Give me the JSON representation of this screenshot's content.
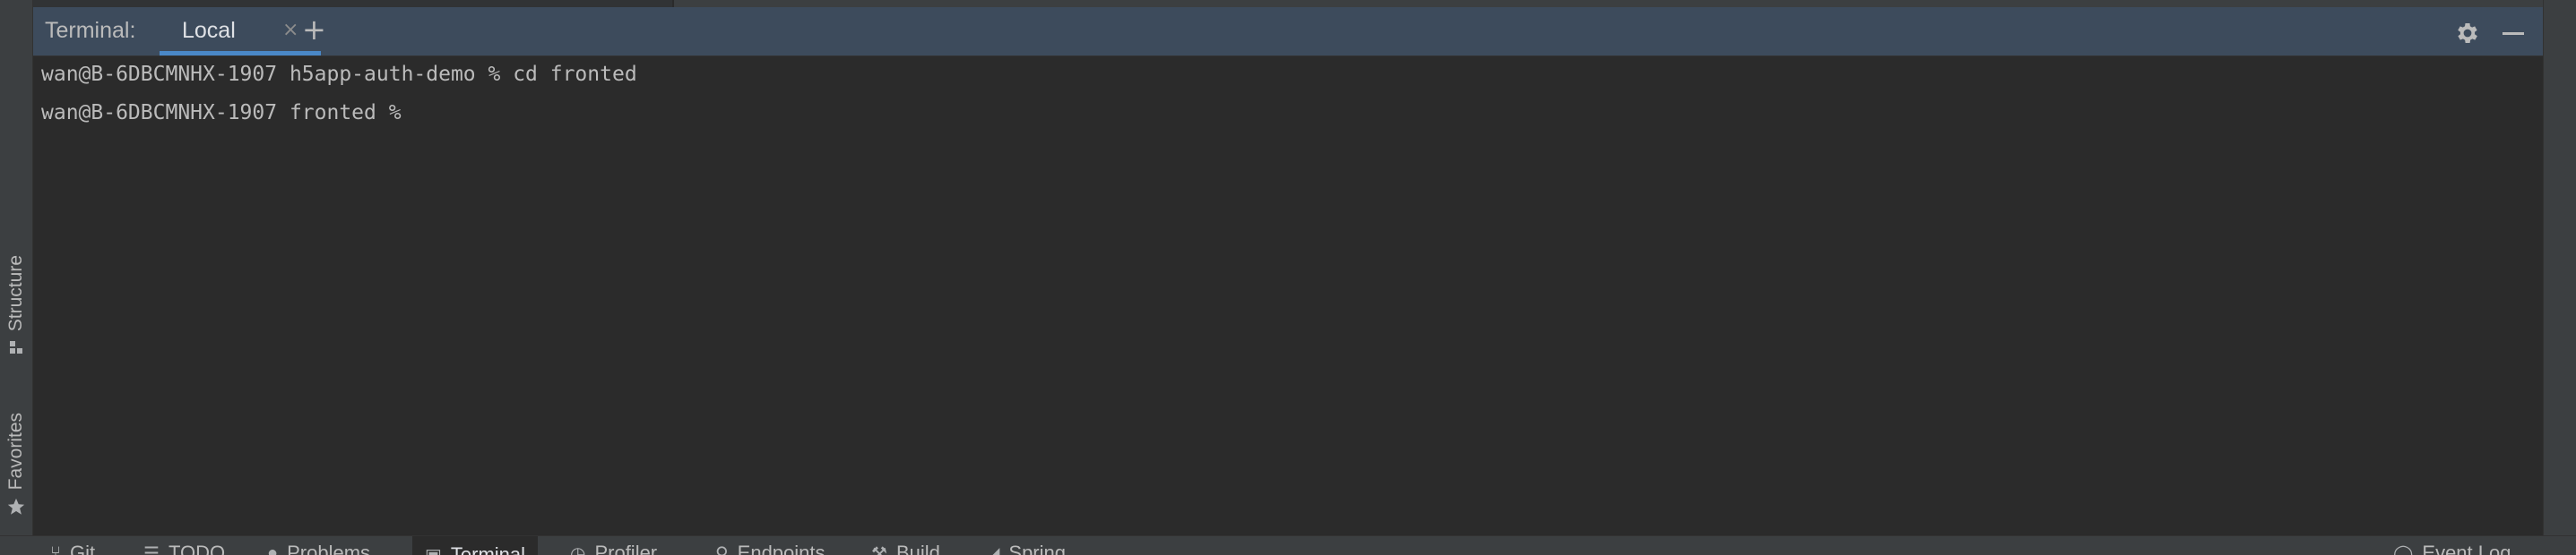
{
  "toolWindow": {
    "title": "Terminal:",
    "tabs": [
      {
        "label": "Local",
        "close": "×",
        "active": true
      }
    ],
    "add_label": "+",
    "icons": {
      "settings": "gear-icon",
      "minimize": "minimize-icon"
    }
  },
  "leftStripe": {
    "items": [
      {
        "label": "Structure",
        "icon": "structure-icon"
      },
      {
        "label": "Favorites",
        "icon": "star-icon"
      }
    ]
  },
  "terminal": {
    "lines": [
      "wan@B-6DBCMNHX-1907 h5app-auth-demo % cd fronted",
      "wan@B-6DBCMNHX-1907 fronted % "
    ]
  },
  "bottomBar": {
    "items": [
      {
        "label": "Git",
        "icon": "git-icon"
      },
      {
        "label": "TODO",
        "icon": "list-icon"
      },
      {
        "label": "Problems",
        "icon": "problems-icon"
      },
      {
        "label": "Terminal",
        "icon": "terminal-icon",
        "active": true
      },
      {
        "label": "Profiler",
        "icon": "profiler-icon"
      },
      {
        "label": "Endpoints",
        "icon": "endpoints-icon"
      },
      {
        "label": "Build",
        "icon": "build-icon"
      },
      {
        "label": "Spring",
        "icon": "spring-icon"
      },
      {
        "label": "Event Log",
        "icon": "event-log-icon"
      }
    ]
  },
  "colors": {
    "header_bg": "#3d4b5c",
    "terminal_bg": "#2b2b2b",
    "accent": "#4a88c7",
    "text": "#bbbbbb"
  }
}
